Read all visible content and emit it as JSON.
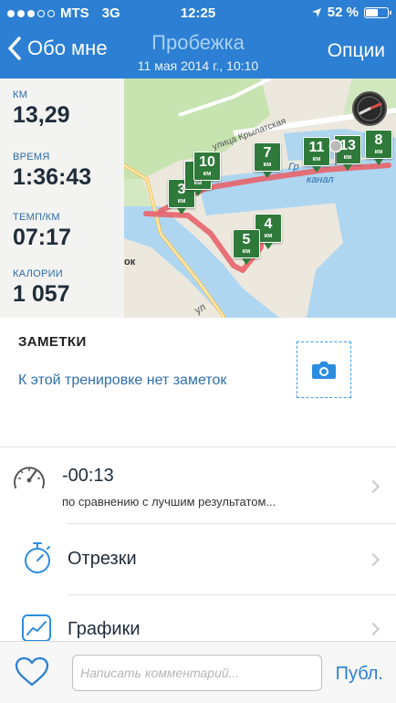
{
  "status": {
    "carrier": "MTS",
    "network": "3G",
    "time": "12:25",
    "battery": "52 %",
    "battery_level": 0.52,
    "signal_bars": 3
  },
  "nav": {
    "back_label": "Обо мне",
    "title": "Пробежка",
    "subtitle": "11 мая 2014 г., 10:10",
    "options_label": "Опции"
  },
  "stats": [
    {
      "label": "км",
      "value": "13,29"
    },
    {
      "label": "время",
      "value": "1:36:43"
    },
    {
      "label": "темп/км",
      "value": "07:17"
    },
    {
      "label": "калории",
      "value": "1 057"
    }
  ],
  "map": {
    "labels": {
      "street": "улица Крылатская",
      "canal_1": "Гр",
      "canal_2": "канал",
      "left_text": "ок",
      "bottom_text": "ул"
    },
    "markers": [
      {
        "n": "3",
        "unit": "км"
      },
      {
        "n": "6",
        "unit": "км"
      },
      {
        "n": "10",
        "unit": "км"
      },
      {
        "n": "7",
        "unit": "км"
      },
      {
        "n": "11",
        "unit": "км"
      },
      {
        "n": "13",
        "unit": "км"
      },
      {
        "n": "8",
        "unit": "км"
      },
      {
        "n": "4",
        "unit": "км"
      },
      {
        "n": "5",
        "unit": "км"
      }
    ],
    "colors": {
      "route": "#e8636a",
      "marker": "#2f7a3a",
      "water": "#aed6f1",
      "park": "#c7e3b0"
    }
  },
  "notes": {
    "title": "ЗАМЕТКИ",
    "empty_text": "К этой тренировке нет заметок"
  },
  "comparison": {
    "value": "-00:13",
    "subtitle": "по сравнению с лучшим результатом..."
  },
  "segments": {
    "label": "Отрезки"
  },
  "graphs": {
    "label": "Графики"
  },
  "bottom": {
    "comment_placeholder": "Написать комментарий...",
    "publish_label": "Публ."
  },
  "colors": {
    "accent": "#2c7fd2",
    "stat_label": "#2b6ca8",
    "notes_text": "#2f6fab"
  }
}
